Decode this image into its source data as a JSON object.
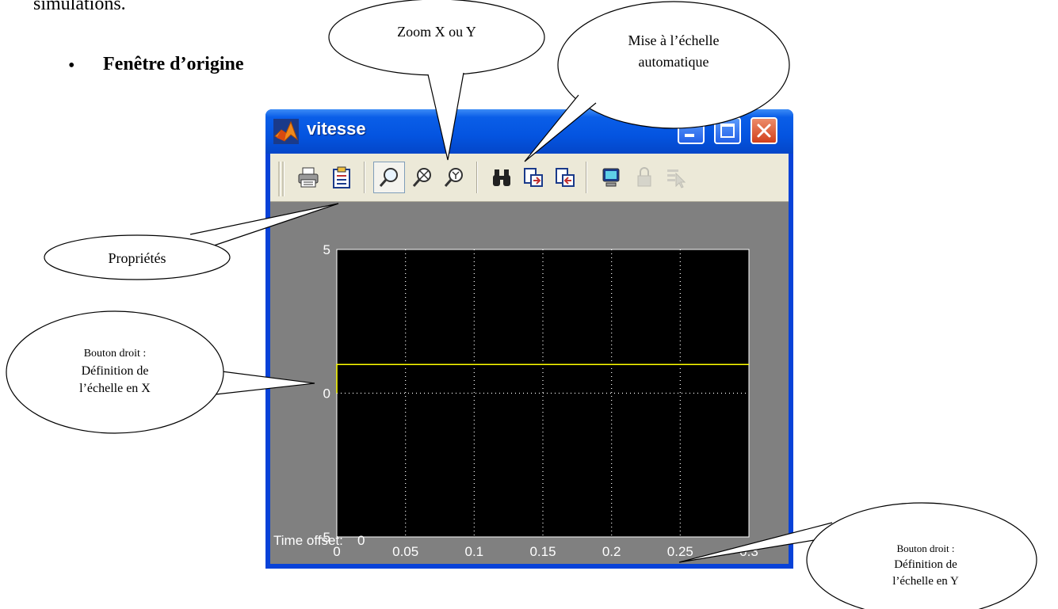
{
  "document": {
    "top_line": "simulations.",
    "bullet": "•",
    "heading": "Fenêtre d’origine"
  },
  "window": {
    "title": "vitesse",
    "app_icon": "matlab-icon",
    "caption_buttons": [
      "minimize-icon",
      "maximize-icon",
      "close-icon"
    ],
    "colors": {
      "titlebar": "#0454e0",
      "close": "#d2401c",
      "toolbar": "#ece9d8"
    }
  },
  "toolbar": {
    "buttons": [
      {
        "name": "print-icon",
        "state": "normal"
      },
      {
        "name": "parameters-icon",
        "state": "normal"
      },
      {
        "name": "zoom-icon",
        "state": "pressed"
      },
      {
        "name": "zoom-x-icon",
        "state": "normal"
      },
      {
        "name": "zoom-y-icon",
        "state": "normal"
      },
      {
        "name": "autoscale-binoculars-icon",
        "state": "normal"
      },
      {
        "name": "save-axes-settings-icon",
        "state": "normal"
      },
      {
        "name": "restore-axes-settings-icon",
        "state": "normal"
      },
      {
        "name": "floating-scope-icon",
        "state": "normal"
      },
      {
        "name": "lock-axes-icon",
        "state": "disabled"
      },
      {
        "name": "signal-selection-icon",
        "state": "disabled"
      }
    ]
  },
  "scope": {
    "time_offset_label": "Time offset:",
    "time_offset_value": "0",
    "colors": {
      "background": "#808080",
      "axes": "#000000",
      "signal": "#ffff00",
      "grid": "#ffffff"
    }
  },
  "chart_data": {
    "type": "line",
    "title": "",
    "xlabel": "",
    "ylabel": "",
    "xlim": [
      0,
      0.3
    ],
    "ylim": [
      -5,
      5
    ],
    "x_ticks": [
      "0",
      "0.05",
      "0.1",
      "0.15",
      "0.2",
      "0.25",
      "0.3"
    ],
    "y_ticks": [
      "5",
      "0",
      "-5"
    ],
    "grid": true,
    "series": [
      {
        "x": [
          0,
          0,
          0.3
        ],
        "y": [
          0,
          1,
          1
        ],
        "color": "#ffff00"
      }
    ]
  },
  "callouts": {
    "zoom": "Zoom X ou Y",
    "autoscale": [
      "Mise à l’échelle",
      "automatique"
    ],
    "properties": "Propriétés",
    "x_scale": [
      "Bouton droit :",
      "Définition de",
      "l’échelle en X"
    ],
    "y_scale": [
      "Bouton droit :",
      "Définition de",
      "l’échelle en Y"
    ]
  }
}
